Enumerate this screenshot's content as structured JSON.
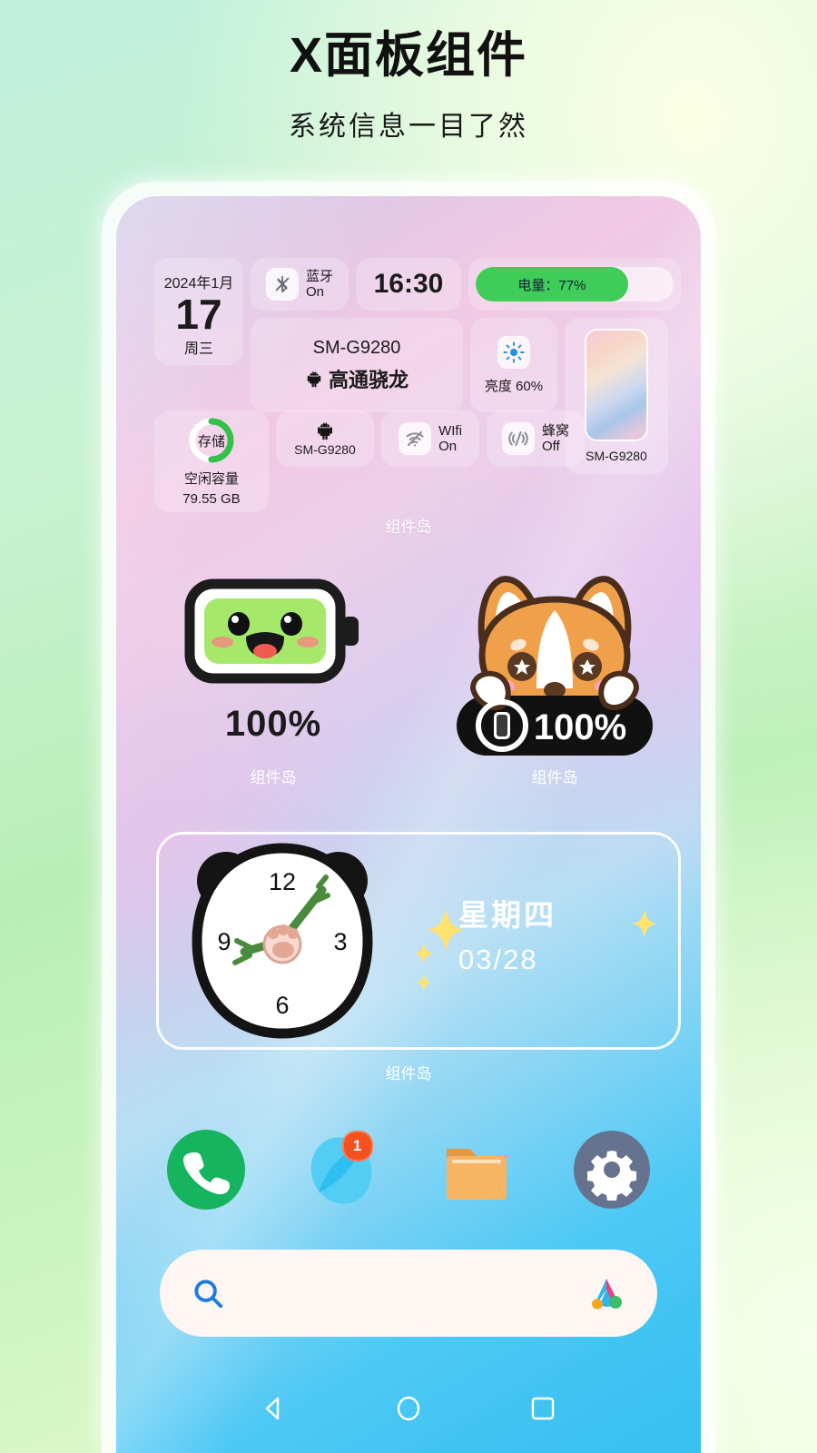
{
  "header": {
    "title": "X面板组件",
    "subtitle": "系统信息一目了然"
  },
  "island": {
    "date": {
      "month": "2024年1月",
      "day": "17",
      "weekday": "周三"
    },
    "bluetooth": {
      "name": "蓝牙",
      "state": "On",
      "icon": "bluetooth-off-icon"
    },
    "clock": {
      "time": "16:30"
    },
    "battery_bar": {
      "label": "电量：77%",
      "percent": 77,
      "fill_color": "#3fcc58"
    },
    "device": {
      "model": "SM-G9280",
      "chipset": "高通骁龙",
      "icon": "android-icon"
    },
    "brightness": {
      "label": "亮度 60%",
      "percent": 60,
      "icon": "sun-icon",
      "icon_color": "#1e90e8"
    },
    "phone_card": {
      "label": "SM-G9280",
      "icon": "phone-mockup-icon"
    },
    "storage": {
      "ring_label": "存储",
      "caption": "空闲容量",
      "value": "79.55 GB",
      "used_percent": 50,
      "ring_color": "#33c04b"
    },
    "device_small": {
      "label": "SM-G9280",
      "icon": "android-icon"
    },
    "wifi": {
      "name": "WIfi",
      "state": "On",
      "icon": "wifi-off-icon"
    },
    "cellular": {
      "name": "蜂窝",
      "state": "Off",
      "icon": "cellular-off-icon"
    },
    "group_label": "组件岛"
  },
  "widgets": {
    "battery_face": {
      "percent_text": "100%",
      "label": "组件岛",
      "fill_color": "#a5e86a"
    },
    "corgi_battery": {
      "percent_text": "100%",
      "label": "组件岛",
      "pill_color": "#111111"
    },
    "panda_clock": {
      "numerals": [
        "12",
        "3",
        "6",
        "9"
      ],
      "weekday": "星期四",
      "date": "03/28",
      "label": "组件岛"
    }
  },
  "dock": {
    "apps": [
      {
        "name": "phone-app",
        "icon": "phone-icon",
        "color": "#17b45f",
        "badge": null
      },
      {
        "name": "browser-app",
        "icon": "browser-icon",
        "color": "#3fc6f0",
        "badge": "1"
      },
      {
        "name": "files-app",
        "icon": "folder-icon",
        "color": "#f4b45e",
        "badge": null
      },
      {
        "name": "settings-app",
        "icon": "gear-icon",
        "color": "#65738f",
        "badge": null
      }
    ]
  },
  "search": {
    "placeholder": "",
    "value": "",
    "search_icon": "magnifier-icon",
    "assistant_icon": "assistant-a-icon"
  },
  "navbar": {
    "back": "back-triangle-icon",
    "home": "home-circle-icon",
    "recents": "recents-square-icon"
  }
}
